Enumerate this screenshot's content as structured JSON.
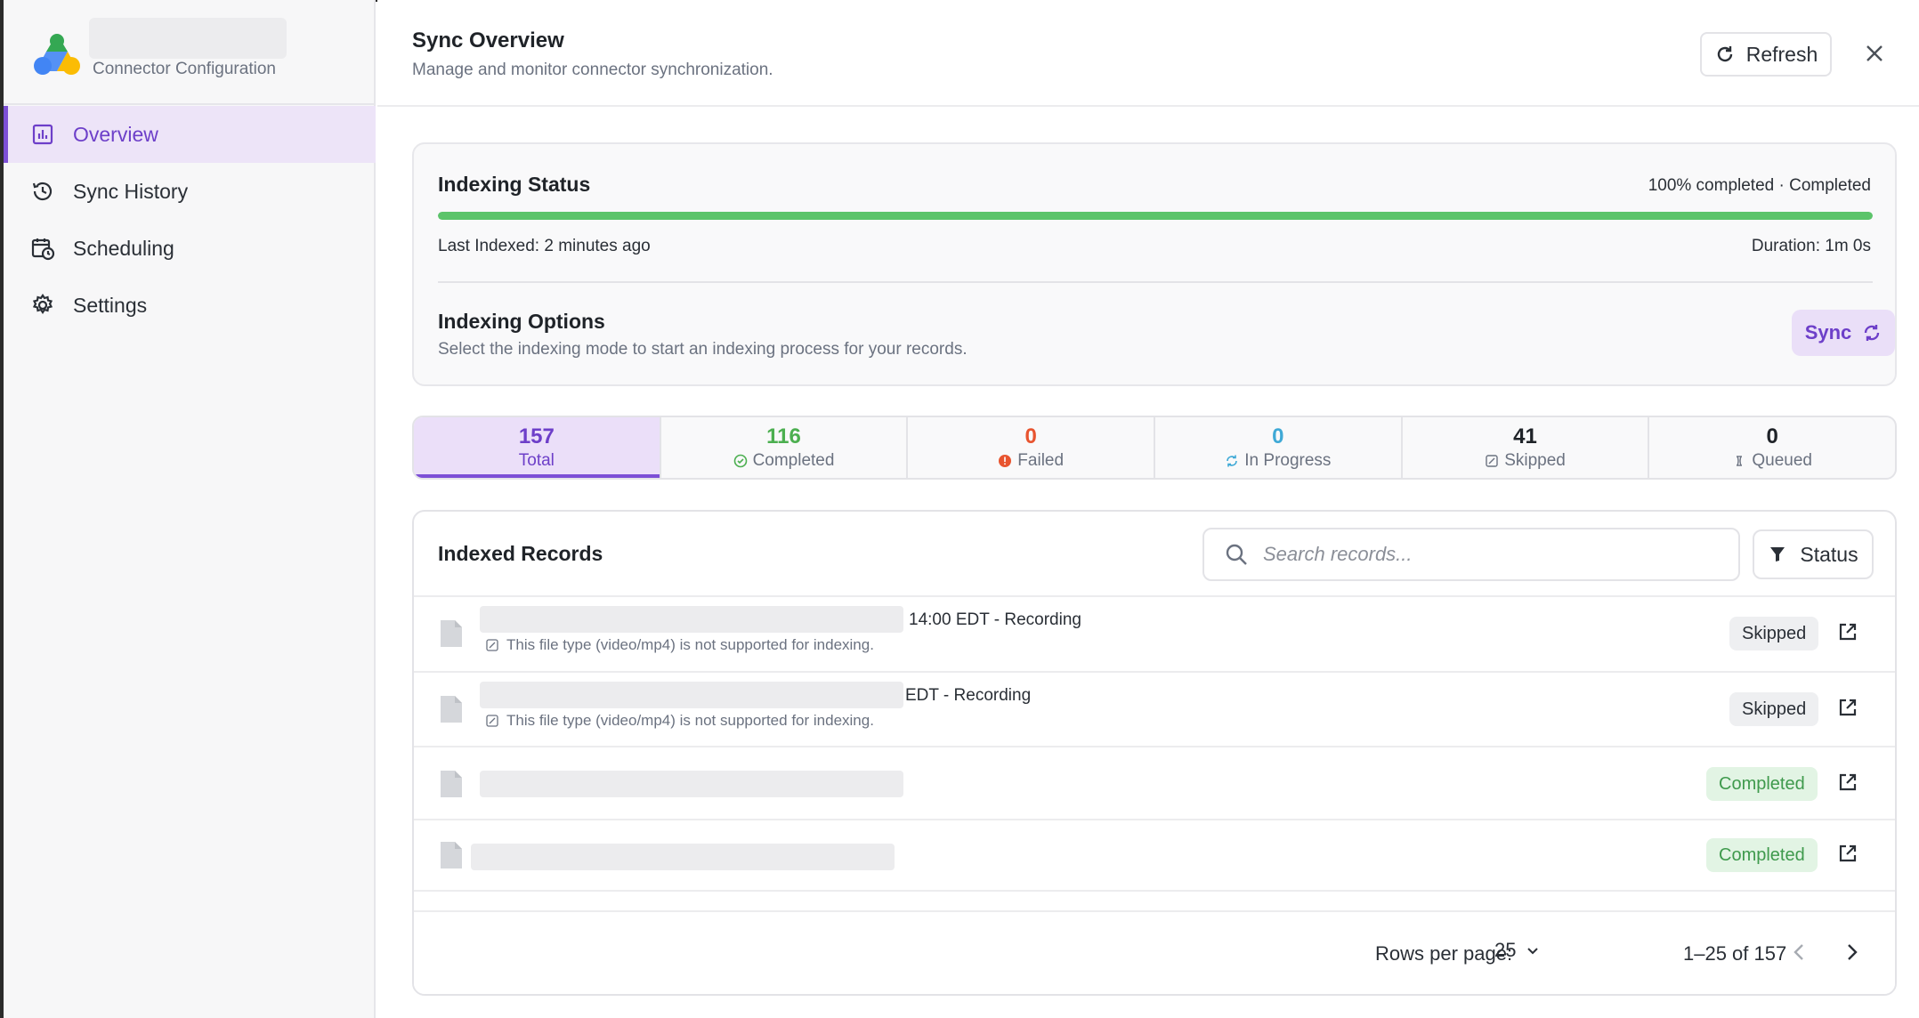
{
  "brand": {
    "subtitle": "Connector Configuration"
  },
  "sidebar": {
    "items": [
      {
        "label": "Overview",
        "icon": "chart-icon",
        "active": true
      },
      {
        "label": "Sync History",
        "icon": "history-icon"
      },
      {
        "label": "Scheduling",
        "icon": "calendar-clock-icon"
      },
      {
        "label": "Settings",
        "icon": "gear-icon"
      }
    ]
  },
  "header": {
    "title": "Sync Overview",
    "subtitle": "Manage and monitor connector synchronization.",
    "refresh_label": "Refresh"
  },
  "indexing": {
    "title": "Indexing Status",
    "status_text": "100% completed · Completed",
    "progress_fraction": 1.0,
    "last_indexed": "Last Indexed: 2 minutes ago",
    "duration": "Duration: 1m 0s",
    "options_title": "Indexing Options",
    "options_desc": "Select the indexing mode to start an indexing process for your records.",
    "sync_label": "Sync"
  },
  "stats": [
    {
      "value": "157",
      "label": "Total",
      "color": "#6d3fc9",
      "icon": "",
      "active": true
    },
    {
      "value": "116",
      "label": "Completed",
      "color": "#4caf50",
      "icon": "check-circle-icon"
    },
    {
      "value": "0",
      "label": "Failed",
      "color": "#e8542f",
      "icon": "alert-circle-icon"
    },
    {
      "value": "0",
      "label": "In Progress",
      "color": "#3fa9d6",
      "icon": "sync-icon"
    },
    {
      "value": "41",
      "label": "Skipped",
      "color": "#1f2328",
      "icon": "skip-square-icon"
    },
    {
      "value": "0",
      "label": "Queued",
      "color": "#1f2328",
      "icon": "queue-icon"
    }
  ],
  "records": {
    "title": "Indexed Records",
    "search_placeholder": "Search records...",
    "status_filter_label": "Status",
    "rows": [
      {
        "name_suffix": "14:00 EDT - Recording",
        "note": "This file type (video/mp4) is not supported for indexing.",
        "status": "Skipped"
      },
      {
        "name_suffix": "EDT - Recording",
        "note": "This file type (video/mp4) is not supported for indexing.",
        "status": "Skipped"
      },
      {
        "name_suffix": "",
        "note": "",
        "status": "Completed"
      },
      {
        "name_suffix": "",
        "note": "",
        "status": "Completed"
      }
    ],
    "footer": {
      "rows_per_page_label": "Rows per page:",
      "rows_per_page_value": "25",
      "range": "1–25 of 157"
    }
  },
  "colors": {
    "accent": "#7c4fd6",
    "progress": "#5cc46a"
  }
}
